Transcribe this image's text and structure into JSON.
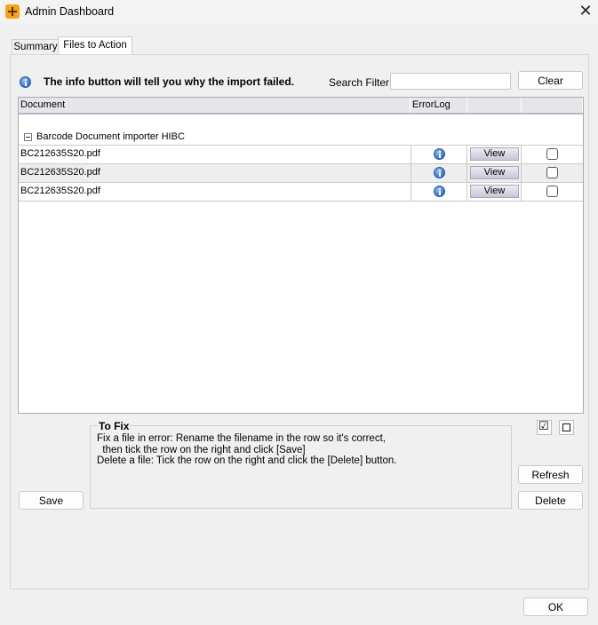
{
  "window": {
    "title": "Admin Dashboard",
    "close_icon": "close-icon",
    "app_icon": "app-plus-icon"
  },
  "tabs": [
    {
      "label": "Summary",
      "active": false
    },
    {
      "label": "Files to Action",
      "active": true
    }
  ],
  "info": {
    "text": "The info button will tell you why the import failed.",
    "icon": "info-icon"
  },
  "search": {
    "label": "Search Filter",
    "value": "",
    "clear_label": "Clear"
  },
  "grid": {
    "columns": [
      "Document",
      "ErrorLog",
      "",
      ""
    ],
    "group_label": "Barcode Document importer HIBC",
    "rows": [
      {
        "document": "BC212635S20.pdf",
        "view_label": "View",
        "checked": false
      },
      {
        "document": "BC212635S20.pdf",
        "view_label": "View",
        "checked": false
      },
      {
        "document": "BC212635S20.pdf",
        "view_label": "View",
        "checked": false
      }
    ]
  },
  "fix": {
    "title": "To Fix",
    "text": "Fix a file in error: Rename the filename in the row so it's correct,\n  then tick the row on the right and click [Save]\nDelete a file: Tick the row on the right and click the [Delete] button."
  },
  "buttons": {
    "save": "Save",
    "refresh": "Refresh",
    "delete": "Delete",
    "ok": "OK"
  },
  "icons": {
    "select_all": "check-all-icon",
    "select_none": "uncheck-all-icon"
  }
}
